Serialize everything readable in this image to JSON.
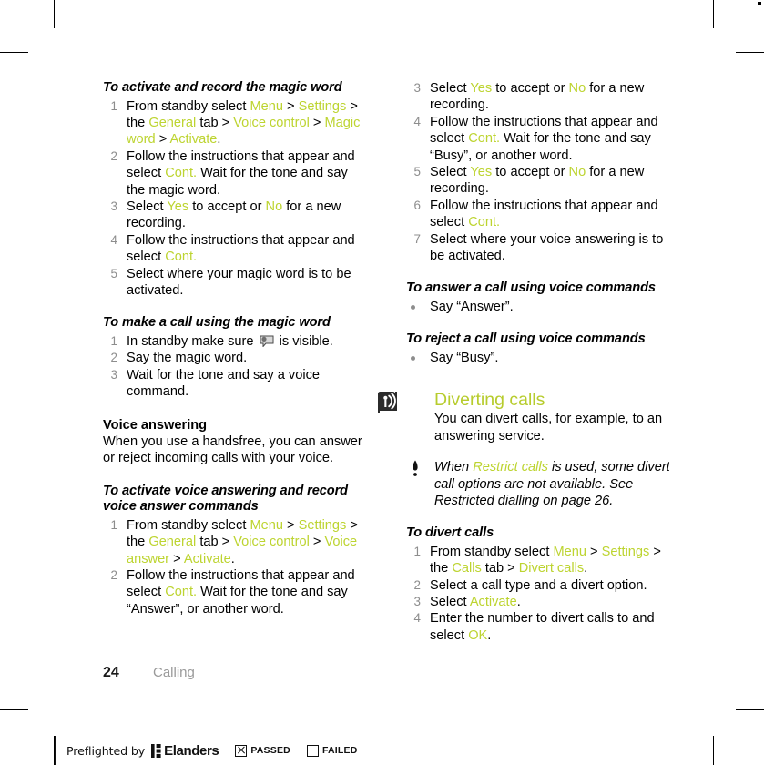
{
  "accent_green": "#bdd430",
  "heading_green": "#b7cc2d",
  "marker_gray": "#8d8d8d",
  "left_column": {
    "section1": {
      "heading": "To activate and record the magic word",
      "steps": [
        {
          "num": "1",
          "runs": [
            {
              "t": "From standby select ",
              "g": false
            },
            {
              "t": "Menu",
              "g": true
            },
            {
              "t": " > ",
              "g": false
            },
            {
              "t": "Settings",
              "g": true
            },
            {
              "t": " > the ",
              "g": false
            },
            {
              "t": "General",
              "g": true
            },
            {
              "t": " tab > ",
              "g": false
            },
            {
              "t": "Voice control",
              "g": true
            },
            {
              "t": " > ",
              "g": false
            },
            {
              "t": "Magic word",
              "g": true
            },
            {
              "t": " > ",
              "g": false
            },
            {
              "t": "Activate",
              "g": true
            },
            {
              "t": ".",
              "g": false
            }
          ]
        },
        {
          "num": "2",
          "runs": [
            {
              "t": "Follow the instructions that appear and select ",
              "g": false
            },
            {
              "t": "Cont.",
              "g": true
            },
            {
              "t": " Wait for the tone and say the magic word.",
              "g": false
            }
          ]
        },
        {
          "num": "3",
          "runs": [
            {
              "t": "Select ",
              "g": false
            },
            {
              "t": "Yes",
              "g": true
            },
            {
              "t": " to accept or ",
              "g": false
            },
            {
              "t": "No",
              "g": true
            },
            {
              "t": " for a new recording.",
              "g": false
            }
          ]
        },
        {
          "num": "4",
          "runs": [
            {
              "t": "Follow the instructions that appear and select ",
              "g": false
            },
            {
              "t": "Cont.",
              "g": true
            }
          ]
        },
        {
          "num": "5",
          "runs": [
            {
              "t": "Select where your magic word is to be activated.",
              "g": false
            }
          ]
        }
      ]
    },
    "section2": {
      "heading": "To make a call using the magic word",
      "steps": [
        {
          "num": "1",
          "runs": [
            {
              "t": "In standby make sure ",
              "g": false
            },
            {
              "icon": "speech-bubble-icon"
            },
            {
              "t": " is visible.",
              "g": false
            }
          ]
        },
        {
          "num": "2",
          "runs": [
            {
              "t": "Say the magic word.",
              "g": false
            }
          ]
        },
        {
          "num": "3",
          "runs": [
            {
              "t": "Wait for the tone and say a voice command.",
              "g": false
            }
          ]
        }
      ]
    },
    "section3": {
      "heading": "Voice answering",
      "body": "When you use a handsfree, you can answer or reject incoming calls with your voice."
    },
    "section4": {
      "heading": "To activate voice answering and record voice answer commands",
      "steps": [
        {
          "num": "1",
          "runs": [
            {
              "t": "From standby select ",
              "g": false
            },
            {
              "t": "Menu",
              "g": true
            },
            {
              "t": " > ",
              "g": false
            },
            {
              "t": "Settings",
              "g": true
            },
            {
              "t": " > the ",
              "g": false
            },
            {
              "t": "General",
              "g": true
            },
            {
              "t": " tab > ",
              "g": false
            },
            {
              "t": "Voice control",
              "g": true
            },
            {
              "t": " > ",
              "g": false
            },
            {
              "t": "Voice answer",
              "g": true
            },
            {
              "t": " > ",
              "g": false
            },
            {
              "t": "Activate",
              "g": true
            },
            {
              "t": ".",
              "g": false
            }
          ]
        },
        {
          "num": "2",
          "runs": [
            {
              "t": "Follow the instructions that appear and select ",
              "g": false
            },
            {
              "t": "Cont.",
              "g": true
            },
            {
              "t": " Wait for the tone and say “Answer”, or another word.",
              "g": false
            }
          ]
        }
      ]
    }
  },
  "right_column": {
    "continued_steps": [
      {
        "num": "3",
        "runs": [
          {
            "t": "Select ",
            "g": false
          },
          {
            "t": "Yes",
            "g": true
          },
          {
            "t": " to accept or ",
            "g": false
          },
          {
            "t": "No",
            "g": true
          },
          {
            "t": " for a new recording.",
            "g": false
          }
        ]
      },
      {
        "num": "4",
        "runs": [
          {
            "t": "Follow the instructions that appear and select ",
            "g": false
          },
          {
            "t": "Cont.",
            "g": true
          },
          {
            "t": " Wait for the tone and say “Busy”, or another word.",
            "g": false
          }
        ]
      },
      {
        "num": "5",
        "runs": [
          {
            "t": "Select ",
            "g": false
          },
          {
            "t": "Yes",
            "g": true
          },
          {
            "t": " to accept or ",
            "g": false
          },
          {
            "t": "No",
            "g": true
          },
          {
            "t": " for a new recording.",
            "g": false
          }
        ]
      },
      {
        "num": "6",
        "runs": [
          {
            "t": "Follow the instructions that appear and select ",
            "g": false
          },
          {
            "t": "Cont.",
            "g": true
          }
        ]
      },
      {
        "num": "7",
        "runs": [
          {
            "t": "Select where your voice answering is to be activated.",
            "g": false
          }
        ]
      }
    ],
    "answer_section": {
      "heading": "To answer a call using voice commands",
      "bullets": [
        {
          "runs": [
            {
              "t": "Say “Answer”.",
              "g": false
            }
          ]
        }
      ]
    },
    "reject_section": {
      "heading": "To reject a call using voice commands",
      "bullets": [
        {
          "runs": [
            {
              "t": "Say “Busy”.",
              "g": false
            }
          ]
        }
      ]
    },
    "chapter": {
      "icon": "diverting-calls-icon",
      "title": "Diverting calls",
      "body": "You can divert calls, for example, to an answering service."
    },
    "note": {
      "icon": "exclamation-icon",
      "runs": [
        {
          "t": "When ",
          "g": false
        },
        {
          "t": "Restrict calls",
          "g": true
        },
        {
          "t": " is used, some divert call options are not available. See Restricted dialling on page 26.",
          "g": false
        }
      ]
    },
    "divert_section": {
      "heading": "To divert calls",
      "steps": [
        {
          "num": "1",
          "runs": [
            {
              "t": "From standby select ",
              "g": false
            },
            {
              "t": "Menu",
              "g": true
            },
            {
              "t": " > ",
              "g": false
            },
            {
              "t": "Settings",
              "g": true
            },
            {
              "t": " > the ",
              "g": false
            },
            {
              "t": "Calls",
              "g": true
            },
            {
              "t": " tab > ",
              "g": false
            },
            {
              "t": "Divert calls",
              "g": true
            },
            {
              "t": ".",
              "g": false
            }
          ]
        },
        {
          "num": "2",
          "runs": [
            {
              "t": "Select a call type and a divert option.",
              "g": false
            }
          ]
        },
        {
          "num": "3",
          "runs": [
            {
              "t": "Select ",
              "g": false
            },
            {
              "t": "Activate",
              "g": true
            },
            {
              "t": ".",
              "g": false
            }
          ]
        },
        {
          "num": "4",
          "runs": [
            {
              "t": "Enter the number to divert calls to and select ",
              "g": false
            },
            {
              "t": "OK",
              "g": true
            },
            {
              "t": ".",
              "g": false
            }
          ]
        }
      ]
    }
  },
  "footer": {
    "page_number": "24",
    "chapter_name": "Calling"
  },
  "preflight": {
    "label": "Preflighted by",
    "logo_text": "Elanders",
    "logo_mark_icon": "elanders-mark-icon",
    "passed_label": "PASSED",
    "passed_checked": true,
    "failed_label": "FAILED",
    "failed_checked": false
  }
}
